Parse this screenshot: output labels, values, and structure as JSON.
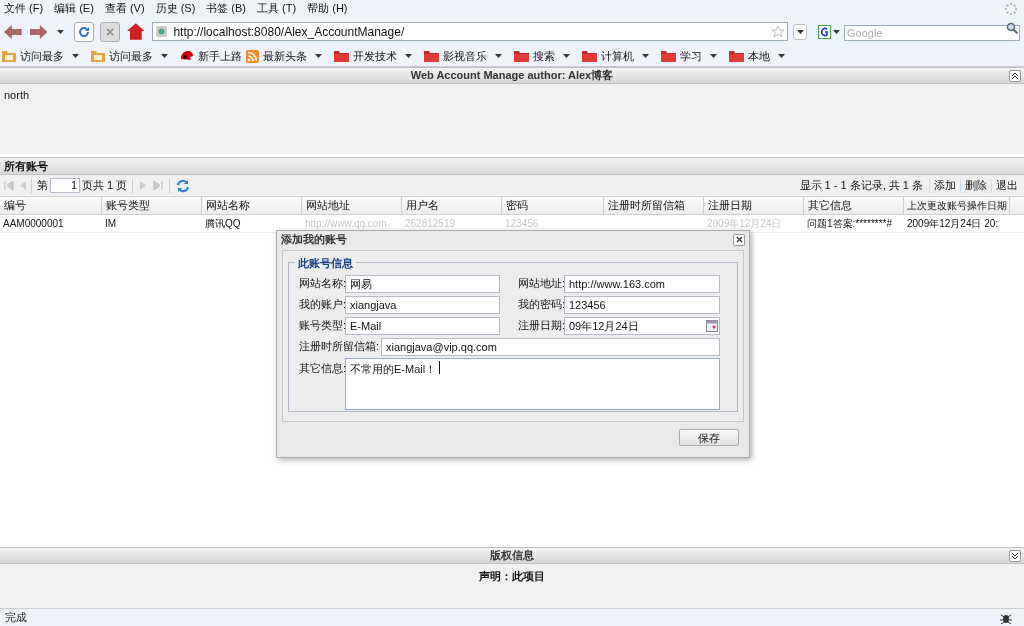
{
  "menu": [
    "文件 (F)",
    "编辑 (E)",
    "查看 (V)",
    "历史 (S)",
    "书签 (B)",
    "工具 (T)",
    "帮助 (H)"
  ],
  "address": {
    "url": "http://localhost:8080/Alex_AccountManage/"
  },
  "search": {
    "placeholder": "Google"
  },
  "bookmarks": [
    {
      "label": "访问最多",
      "kind": "smart",
      "dropdown": true
    },
    {
      "label": "访问最多",
      "kind": "smart",
      "dropdown": true
    },
    {
      "label": "新手上路",
      "kind": "hat",
      "dropdown": false
    },
    {
      "label": "最新头条",
      "kind": "rss",
      "dropdown": true
    },
    {
      "label": "开发技术",
      "kind": "folder",
      "dropdown": true
    },
    {
      "label": "影视音乐",
      "kind": "folder",
      "dropdown": true
    },
    {
      "label": "搜索",
      "kind": "folder",
      "dropdown": true
    },
    {
      "label": "计算机",
      "kind": "folder",
      "dropdown": true
    },
    {
      "label": "学习",
      "kind": "folder",
      "dropdown": true
    },
    {
      "label": "本地",
      "kind": "folder",
      "dropdown": true
    }
  ],
  "north_panel": {
    "title": "Web Account Manage author: Alex博客",
    "body": "north"
  },
  "grid_panel": {
    "title": "所有账号",
    "pager": {
      "page_prefix": "第",
      "page": "1",
      "page_suffix": "页共 1 页",
      "summary": "显示 1 - 1 条记录, 共 1 条",
      "actions": [
        "添加",
        "删除",
        "退出"
      ]
    },
    "columns": [
      "编号",
      "账号类型",
      "网站名称",
      "网站地址",
      "用户名",
      "密码",
      "注册时所留信箱",
      "注册日期",
      "其它信息",
      "上次更改账号操作日期"
    ],
    "rows": [
      {
        "cells": [
          {
            "text": "AAM0000001",
            "covered": false
          },
          {
            "text": "IM",
            "covered": false
          },
          {
            "text": "腾讯QQ",
            "covered": false
          },
          {
            "text": "http://www.qq.com",
            "covered": true
          },
          {
            "text": "262812519",
            "covered": true
          },
          {
            "text": "123456",
            "covered": true
          },
          null,
          {
            "text": "2009年12月24日",
            "covered": true
          },
          {
            "text": "问题1答案:********#",
            "covered": false
          },
          {
            "text": "2009年12月24日 20:",
            "covered": false
          }
        ]
      }
    ]
  },
  "dialog": {
    "title": "添加我的账号",
    "legend": "此账号信息",
    "fields": [
      {
        "label": "网站名称:",
        "value": "网易"
      },
      {
        "label": "网站地址:",
        "value": "http://www.163.com"
      },
      {
        "label": "我的账户:",
        "value": "xiangjava"
      },
      {
        "label": "我的密码:",
        "value": "123456"
      },
      {
        "label": "账号类型:",
        "value": "E-Mail"
      },
      {
        "label": "注册日期:",
        "value": "09年12月24日"
      }
    ],
    "email": {
      "label": "注册时所留信箱:",
      "value": "xiangjava@vip.qq.com"
    },
    "notes": {
      "label": "其它信息:",
      "value": "不常用的E-Mail！"
    },
    "save": "保存"
  },
  "south_panel": {
    "title": "版权信息",
    "body": "声明：此项目"
  },
  "status_bar": {
    "text": "完成"
  }
}
